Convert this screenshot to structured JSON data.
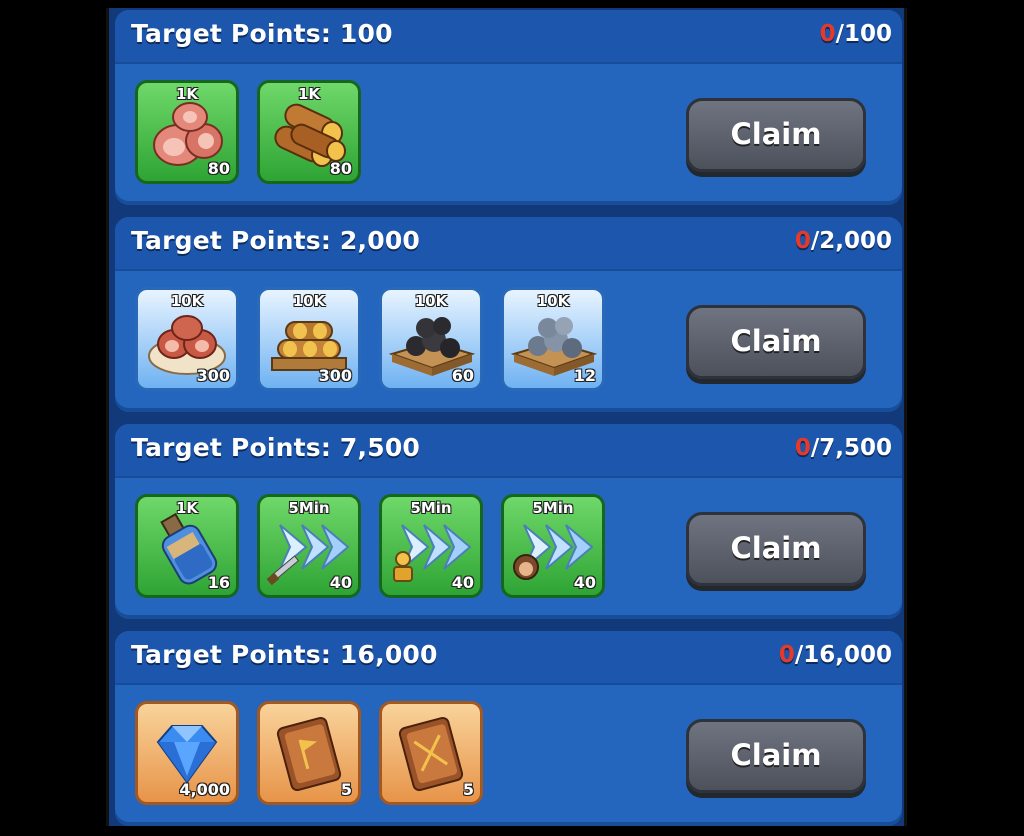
{
  "tiers": [
    {
      "title": "Target Points: 100",
      "progress_current": "0",
      "progress_total": "/100",
      "claim_label": "Claim",
      "rewards": [
        {
          "icon": "meat-icon",
          "amount": "1K",
          "count": "80",
          "frame": "green"
        },
        {
          "icon": "wood-icon",
          "amount": "1K",
          "count": "80",
          "frame": "green"
        }
      ]
    },
    {
      "title": "Target Points: 2,000",
      "progress_current": "0",
      "progress_total": "/2,000",
      "claim_label": "Claim",
      "rewards": [
        {
          "icon": "meat-platter-icon",
          "amount": "10K",
          "count": "300",
          "frame": "blue"
        },
        {
          "icon": "wood-pallet-icon",
          "amount": "10K",
          "count": "300",
          "frame": "blue"
        },
        {
          "icon": "coal-pallet-icon",
          "amount": "10K",
          "count": "60",
          "frame": "blue"
        },
        {
          "icon": "iron-ore-pallet-icon",
          "amount": "10K",
          "count": "12",
          "frame": "blue"
        }
      ]
    },
    {
      "title": "Target Points: 7,500",
      "progress_current": "0",
      "progress_total": "/7,500",
      "claim_label": "Claim",
      "rewards": [
        {
          "icon": "xp-potion-icon",
          "amount": "1K",
          "count": "16",
          "frame": "green"
        },
        {
          "icon": "speedup-sword-icon",
          "amount": "5Min",
          "count": "40",
          "frame": "green"
        },
        {
          "icon": "speedup-research-icon",
          "amount": "5Min",
          "count": "40",
          "frame": "green"
        },
        {
          "icon": "speedup-training-icon",
          "amount": "5Min",
          "count": "40",
          "frame": "green"
        }
      ]
    },
    {
      "title": "Target Points: 16,000",
      "progress_current": "0",
      "progress_total": "/16,000",
      "claim_label": "Claim",
      "rewards": [
        {
          "icon": "gem-icon",
          "amount": "",
          "count": "4,000",
          "frame": "orange"
        },
        {
          "icon": "flag-book-icon",
          "amount": "",
          "count": "5",
          "frame": "orange"
        },
        {
          "icon": "sword-book-icon",
          "amount": "",
          "count": "5",
          "frame": "orange"
        }
      ]
    }
  ],
  "colors": {
    "panel_bg": "#123a7a",
    "tier_bg": "#2466bd",
    "progress_current": "#e43a2b",
    "claim_button": "#5d626d"
  }
}
